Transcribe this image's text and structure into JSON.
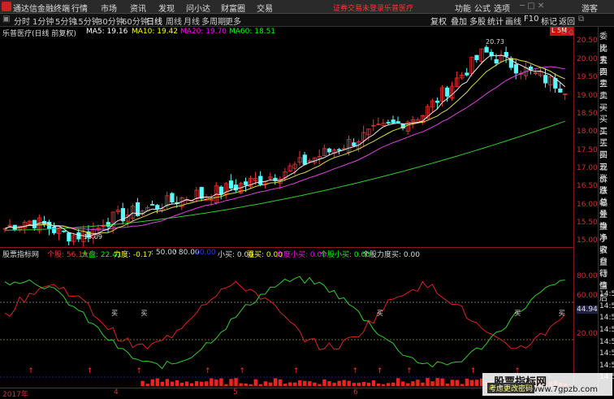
{
  "topbar": {
    "title": "通达信金融终端",
    "menus": [
      "行情",
      "市场",
      "资讯",
      "发现",
      "问小达",
      "财富圈",
      "交易"
    ],
    "warning": "证券交易未登录",
    "stock_link": "乐普医疗",
    "right": [
      "功能",
      "公式",
      "选项"
    ],
    "guest": "游客"
  },
  "toolbar": {
    "periods": [
      "分时",
      "1分钟",
      "5分钟",
      "15分钟",
      "30分钟",
      "60分钟",
      "日线",
      "周线",
      "月线",
      "多周期",
      "更多"
    ],
    "active": "日线",
    "right_buttons": [
      "复权",
      "叠加",
      "多股",
      "统计",
      "画线",
      "F10",
      "标记",
      "返回"
    ]
  },
  "infobar": {
    "name": "乐普医疗(日线 前复权)",
    "ma5": "MA5: 19.16",
    "ma10": "MA10: 19.42",
    "ma20": "MA20: 19.70",
    "ma60": "MA60: 18.51",
    "high_label": "20.73",
    "low_label": "15.09"
  },
  "price_axis": [
    "20.50",
    "20.00",
    "19.50",
    "19.00",
    "18.50",
    "18.00",
    "17.50",
    "17.00",
    "16.50",
    "16.00",
    "15.50",
    "15.00"
  ],
  "ind_axis": [
    "80.00",
    "60.00",
    "44.94",
    "20.00"
  ],
  "indicator": {
    "name": "股票指标网",
    "geg": "个股: 56.19",
    "dapan": "大盘: 22.41",
    "lidu": "力度: -0.17",
    "f50": ": 50.00",
    "f80": ": 80.00",
    "f20": "20.00",
    "xiaomai": "小买: 0.00",
    "qiangmai": "强买: 0.00",
    "lidu_small": "力度小买: 0.00",
    "geg_small": "个股小买: 0.00",
    "geg_strong": "个股力度买: 0.00",
    "buy_label": "买"
  },
  "datebar": {
    "year": "2017年",
    "months": [
      "4",
      "5",
      "6"
    ]
  },
  "side_panel": [
    "委比",
    "卖五",
    "卖四",
    "卖三",
    "卖二",
    "卖一",
    "买一",
    "买二",
    "买三",
    "买四",
    "买五",
    "现价",
    "涨跌",
    "涨幅",
    "总量",
    "外盘",
    "换手",
    "净资",
    "收益",
    "自动",
    "行情",
    "盘后",
    "14:5",
    "14:5",
    "14:5",
    "14:5",
    "14:5",
    "14:5",
    "14:5",
    "14:5"
  ],
  "watermark": {
    "title": "股票指标网",
    "url": "www.7gpzb.com"
  },
  "hint": "考虑更改密码",
  "badge": "L 5M"
}
